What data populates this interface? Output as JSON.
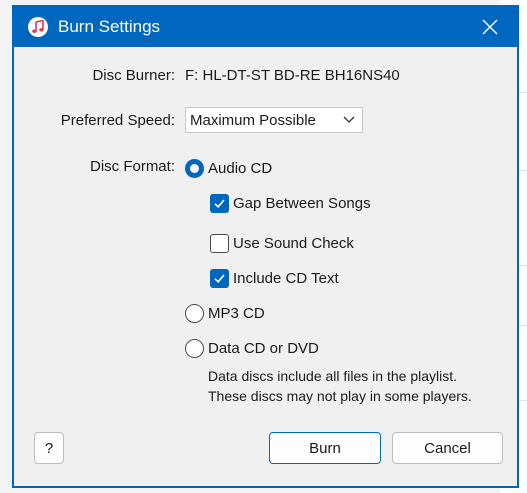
{
  "window": {
    "title": "Burn Settings"
  },
  "disc_burner": {
    "label": "Disc Burner:",
    "value": "F: HL-DT-ST BD-RE  BH16NS40"
  },
  "preferred_speed": {
    "label": "Preferred Speed:",
    "selected": "Maximum Possible"
  },
  "disc_format": {
    "label": "Disc Format:",
    "options": [
      {
        "label": "Audio CD",
        "selected": true
      },
      {
        "label": "MP3 CD",
        "selected": false
      },
      {
        "label": "Data CD or DVD",
        "selected": false
      }
    ],
    "audio_cd_settings": [
      {
        "label": "Gap Between Songs",
        "checked": true
      },
      {
        "label": "Use Sound Check",
        "checked": false
      },
      {
        "label": "Include CD Text",
        "checked": true
      }
    ],
    "data_note_lines": [
      "Data discs include all files in the playlist.",
      "These discs may not play in some players."
    ]
  },
  "buttons": {
    "help": "?",
    "burn": "Burn",
    "cancel": "Cancel"
  },
  "colors": {
    "accent": "#0067c0",
    "dialog_bg": "#f0f0f0"
  }
}
